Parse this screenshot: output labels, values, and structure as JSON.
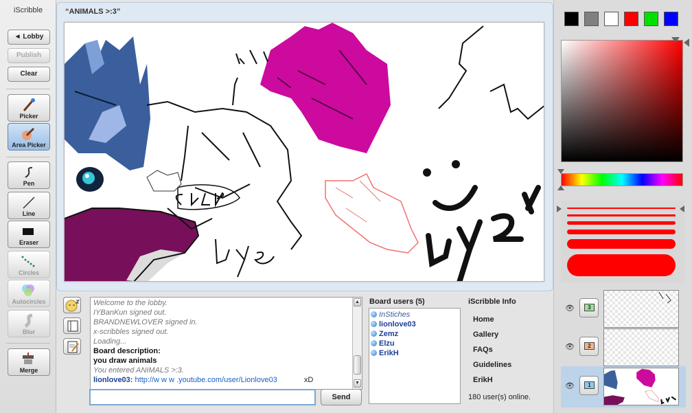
{
  "app": {
    "title": "iScribble"
  },
  "toolbar": {
    "lobby_label": "◄ Lobby",
    "publish_label": "Publish",
    "clear_label": "Clear",
    "tools": [
      {
        "label": "Picker"
      },
      {
        "label": "Area Picker"
      },
      {
        "label": "Pen"
      },
      {
        "label": "Line"
      },
      {
        "label": "Eraser"
      },
      {
        "label": "Circles"
      },
      {
        "label": "Autocircles"
      },
      {
        "label": "Blur"
      },
      {
        "label": "Merge"
      }
    ]
  },
  "board": {
    "title": "“ANIMALS >:3”"
  },
  "chat": {
    "messages": [
      {
        "text": "Welcome to the lobby."
      },
      {
        "text": "IYBanKun signed out."
      },
      {
        "text": "BRANDNEWLOVER signed in."
      },
      {
        "text": "x-scribbles signed out."
      },
      {
        "text": "Loading..."
      },
      {
        "text": "Board description:"
      },
      {
        "text": "you draw animals"
      },
      {
        "text": "You entered ANIMALS >:3."
      },
      {
        "who": "lionlove03:",
        "text": "http://w w w .youtube.com/user/Lionlove03",
        "extra": "xD"
      }
    ],
    "input_value": "",
    "send_label": "Send"
  },
  "users": {
    "title": "Board users (5)",
    "list": [
      "InStiches",
      "lionlove03",
      "Zemz",
      "Elzu",
      "ErikH"
    ]
  },
  "info": {
    "title": "iScribble Info",
    "links": [
      "Home",
      "Gallery",
      "FAQs",
      "Guidelines",
      "ErikH"
    ],
    "online": "180 user(s) online."
  },
  "colors": {
    "swatches": [
      "#000000",
      "#808080",
      "#ffffff",
      "#ff0000",
      "#00e000",
      "#0000ff"
    ],
    "current": "#ff0000"
  },
  "layers": [
    {
      "number": "3",
      "badge_color": "#9be39b"
    },
    {
      "number": "2",
      "badge_color": "#f4b38a"
    },
    {
      "number": "1",
      "badge_color": "#8ec9f0"
    }
  ]
}
